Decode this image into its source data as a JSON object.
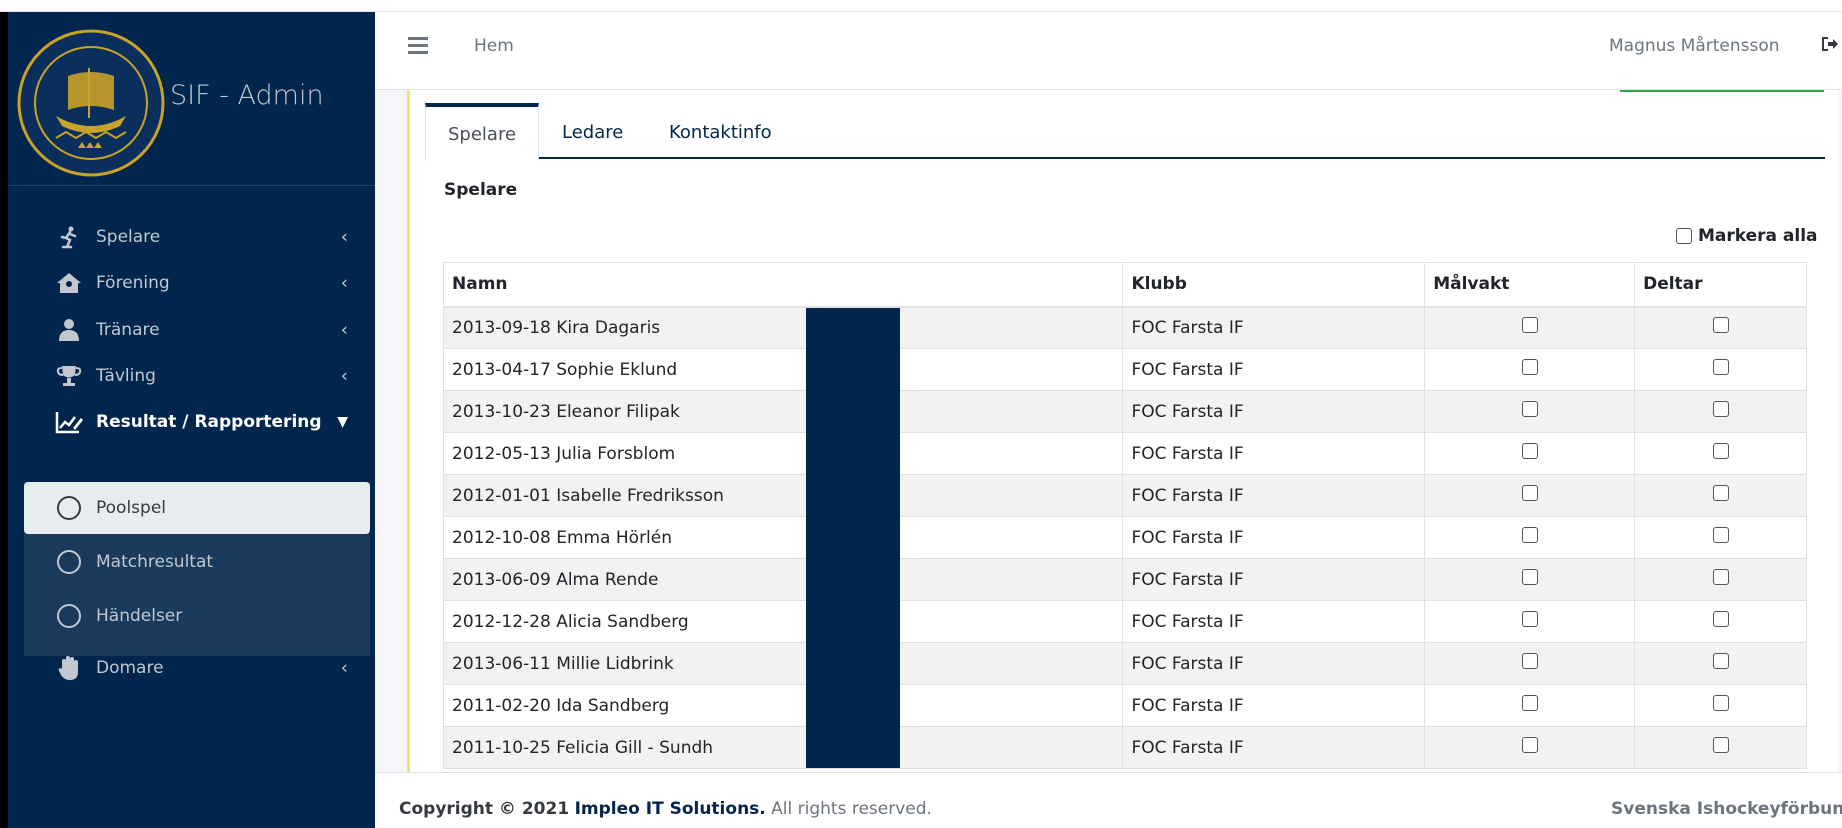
{
  "brand": {
    "title": "SIF - Admin",
    "logo_text": "SVENSKA ISHOCKEYFÖRBUNDET"
  },
  "sidebar": {
    "items": [
      {
        "label": "Spelare",
        "icon": "skater-icon"
      },
      {
        "label": "Förening",
        "icon": "house-icon"
      },
      {
        "label": "Tränare",
        "icon": "coach-icon"
      },
      {
        "label": "Tävling",
        "icon": "trophy-icon"
      },
      {
        "label": "Resultat / Rapportering",
        "icon": "chart-edit-icon"
      },
      {
        "label": "Domare",
        "icon": "hand-icon"
      }
    ],
    "subitems": [
      {
        "label": "Poolspel"
      },
      {
        "label": "Matchresultat"
      },
      {
        "label": "Händelser"
      }
    ]
  },
  "header": {
    "breadcrumb": "Hem",
    "user": "Magnus Mårtensson"
  },
  "tabs": [
    {
      "label": "Spelare"
    },
    {
      "label": "Ledare"
    },
    {
      "label": "Kontaktinfo"
    }
  ],
  "section_title": "Spelare",
  "select_all_label": "Markera alla",
  "table": {
    "headers": [
      "Namn",
      "Klubb",
      "Målvakt",
      "Deltar"
    ],
    "rows": [
      {
        "name": "2013-09-18 Kira Dagaris",
        "club": "FOC Farsta IF"
      },
      {
        "name": "2013-04-17 Sophie Eklund",
        "club": "FOC Farsta IF"
      },
      {
        "name": "2013-10-23 Eleanor Filipak",
        "club": "FOC Farsta IF"
      },
      {
        "name": "2012-05-13 Julia Forsblom",
        "club": "FOC Farsta IF"
      },
      {
        "name": "2012-01-01 Isabelle Fredriksson",
        "club": "FOC Farsta IF"
      },
      {
        "name": "2012-10-08 Emma Hörlén",
        "club": "FOC Farsta IF"
      },
      {
        "name": "2013-06-09 Alma Rende",
        "club": "FOC Farsta IF"
      },
      {
        "name": "2012-12-28 Alicia Sandberg",
        "club": "FOC Farsta IF"
      },
      {
        "name": "2013-06-11 Millie Lidbrink",
        "club": "FOC Farsta IF"
      },
      {
        "name": "2011-02-20 Ida Sandberg",
        "club": "FOC Farsta IF"
      },
      {
        "name": "2011-10-25 Felicia Gill - Sundh",
        "club": "FOC Farsta IF"
      }
    ]
  },
  "footer": {
    "copyright_prefix": "Copyright © 2021",
    "company": "Impleo IT Solutions.",
    "rights": "All rights reserved.",
    "right_text": "Svenska Ishockeyförbunde"
  },
  "colors": {
    "sidebar_bg": "#00264d",
    "accent": "#00264d",
    "card_border": "#f5e36b",
    "green": "#28a745"
  }
}
